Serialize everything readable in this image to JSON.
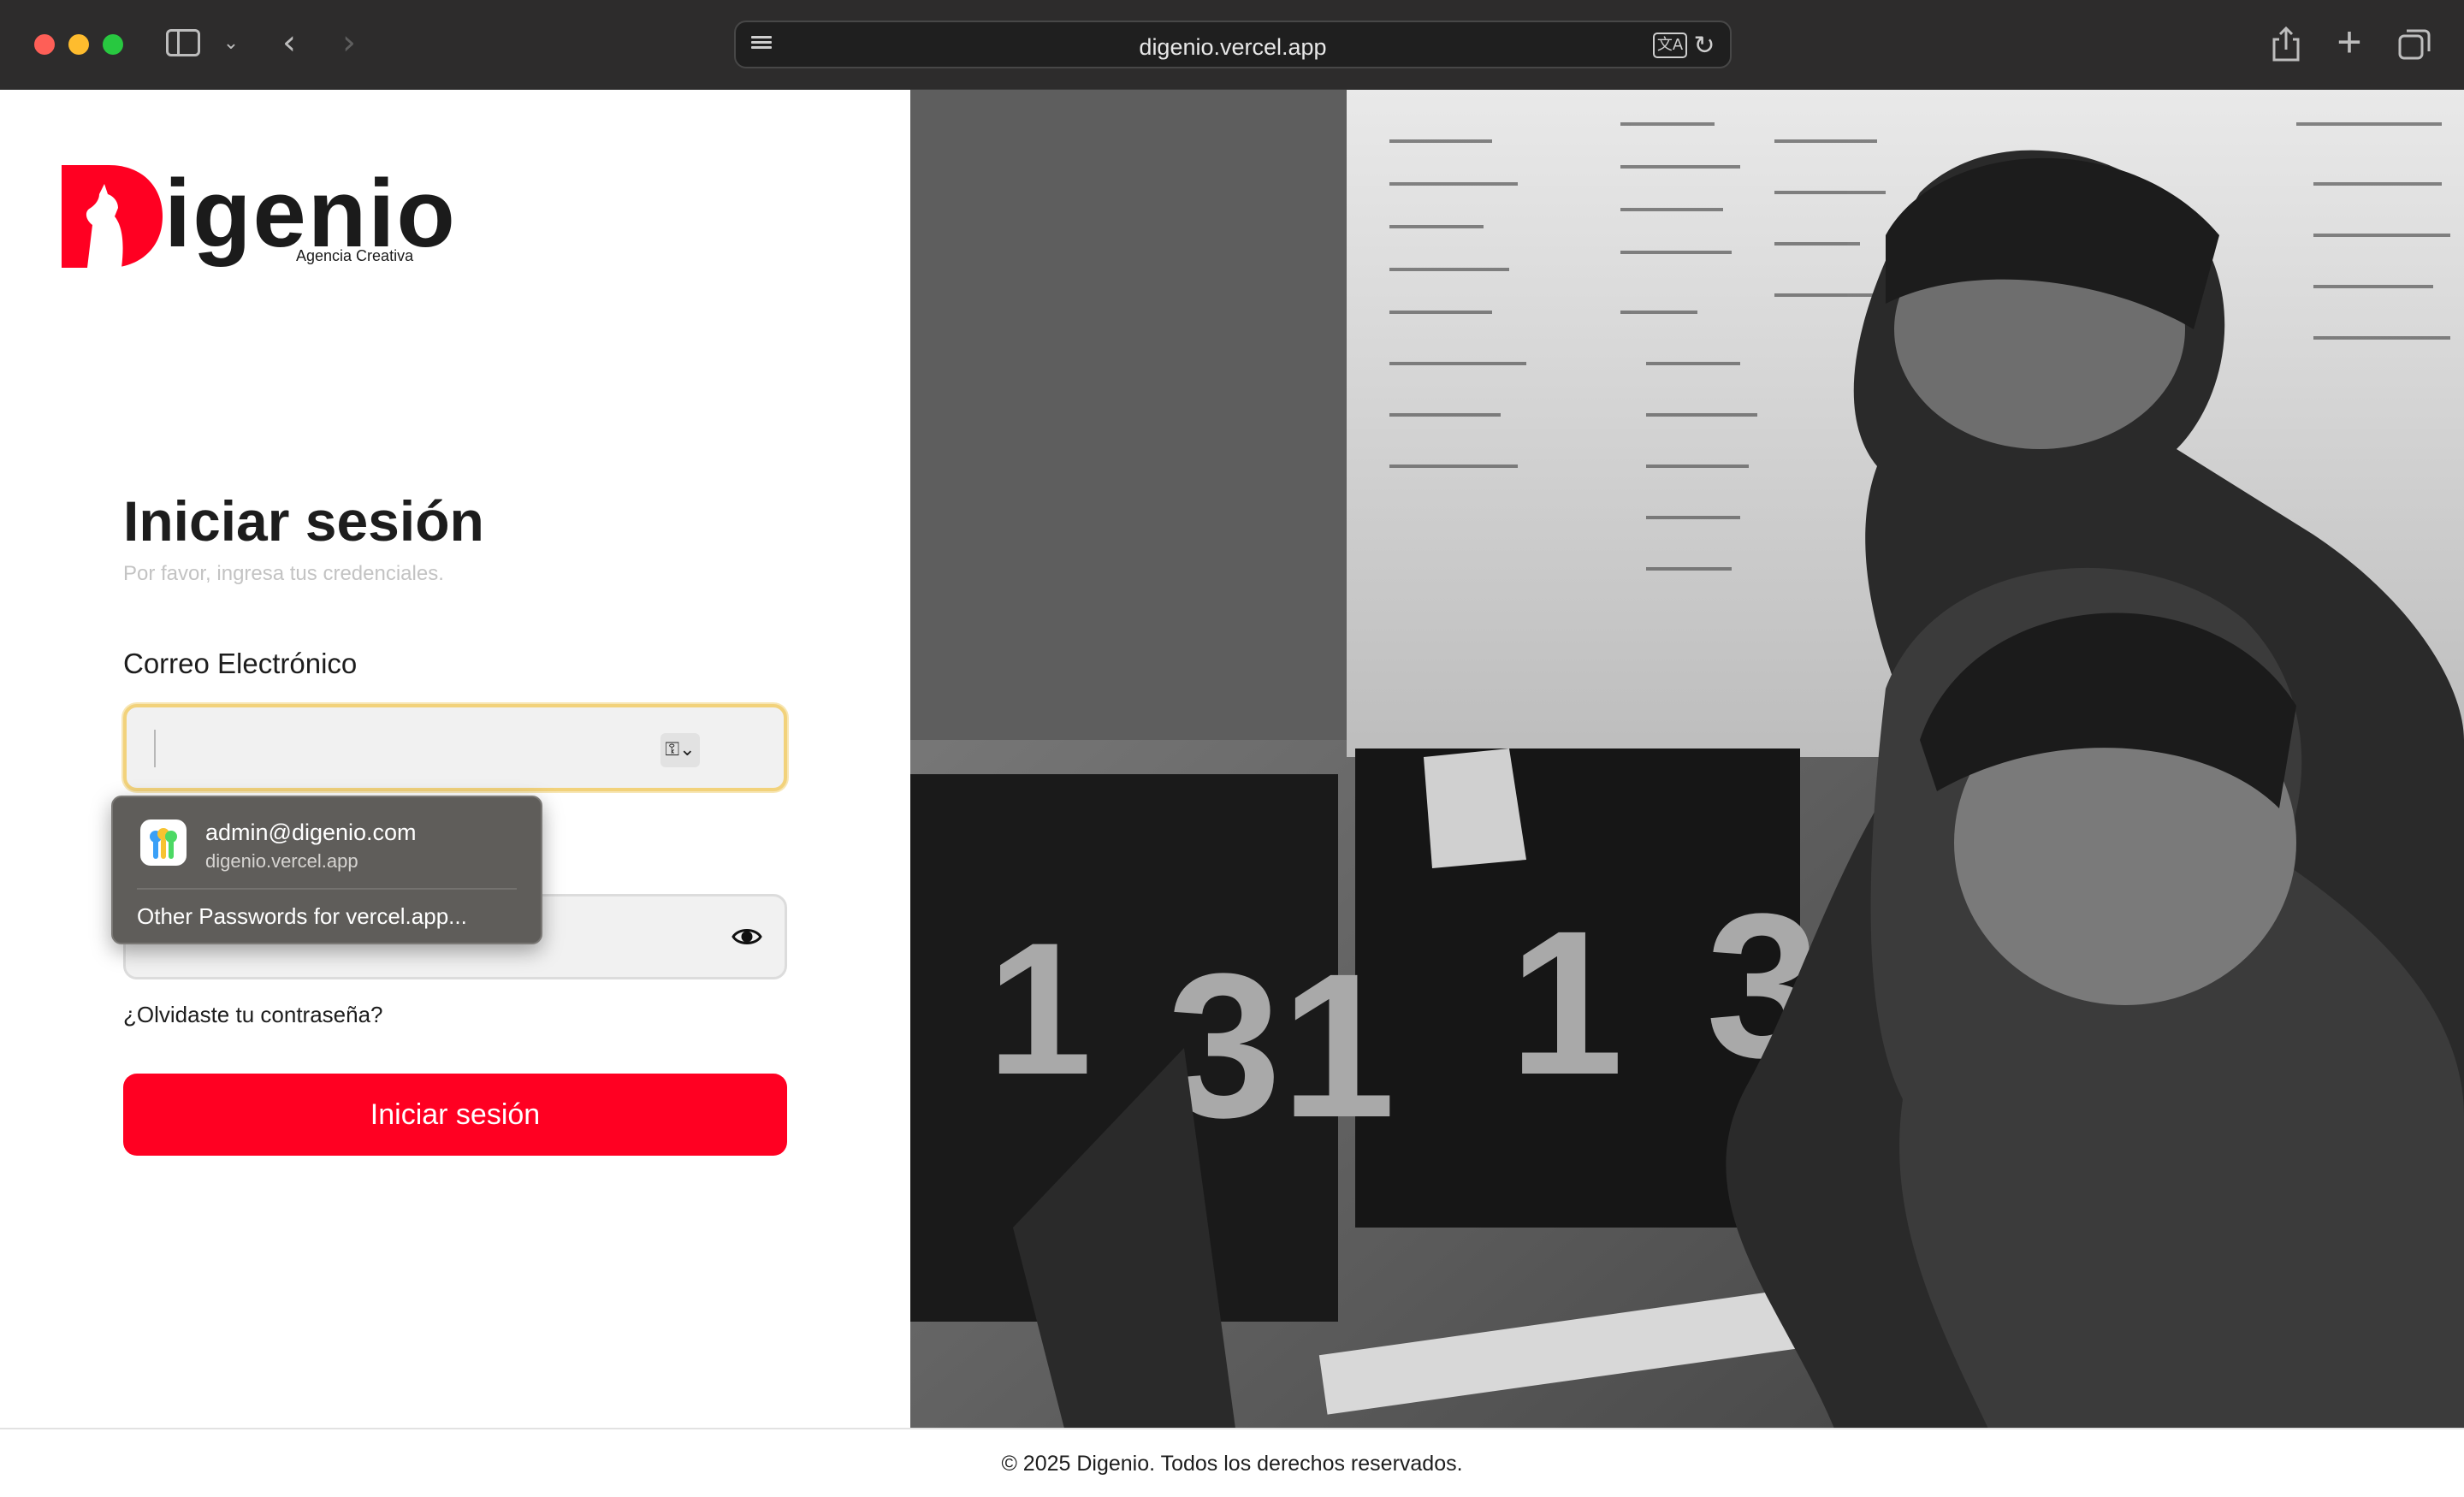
{
  "browser": {
    "url": "digenio.vercel.app",
    "translate_glyph": "文A",
    "reload_glyph": "↻",
    "back_glyph": "‹",
    "forward_glyph": "›",
    "sidebar_chevron_glyph": "⌄",
    "new_tab_glyph": "+",
    "icons": [
      "sidebar-icon",
      "chevron-down-icon",
      "back-arrow-icon",
      "forward-arrow-icon",
      "page-menu-icon",
      "translate-icon",
      "reload-icon",
      "share-icon",
      "plus-icon",
      "tabs-overview-icon"
    ]
  },
  "brand": {
    "name": "igenio",
    "tagline": "Agencia Creativa",
    "color": "#ff0022"
  },
  "login": {
    "title": "Iniciar sesión",
    "subtitle": "Por favor, ingresa tus credenciales.",
    "email_label": "Correo Electrónico",
    "email_value": "",
    "key_glyph": "⚿⌄",
    "forgot_password": "¿Olvidaste tu contraseña?",
    "submit_label": "Iniciar sesión"
  },
  "autofill": {
    "username": "admin@digenio.com",
    "domain": "digenio.vercel.app",
    "other_passwords": "Other Passwords for vercel.app..."
  },
  "footer": {
    "text": "© 2025 Digenio. Todos los derechos reservados."
  },
  "colors": {
    "accent": "#ff0022",
    "focus_ring": "#f2d27b",
    "chrome": "#2d2c2c"
  }
}
